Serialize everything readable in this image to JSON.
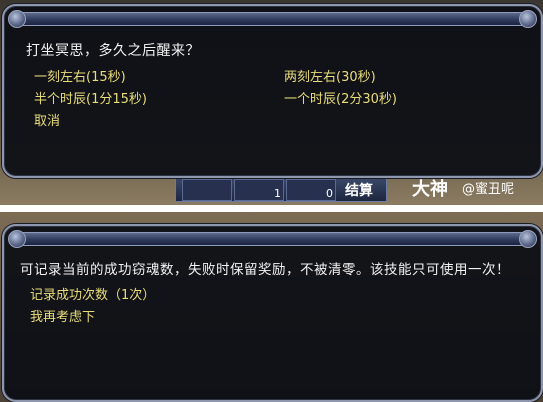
{
  "dialog_one": {
    "question": "打坐冥思，多久之后醒来？",
    "options": [
      "一刻左右(15秒)",
      "两刻左右(30秒)",
      "半个时辰(1分15秒)",
      "一个时辰(2分30秒)",
      "取消"
    ]
  },
  "hud": {
    "slot_counts": [
      "1",
      "0"
    ],
    "settle_label": "结算",
    "brand": "大神",
    "brand_sub": "@蜜丑呢"
  },
  "dialog_two": {
    "message": "可记录当前的成功窃魂数，失败时保留奖励，不被清零。该技能只可使用一次！",
    "options": [
      "记录成功次数（1次）",
      "我再考虑下"
    ]
  },
  "colors": {
    "option_text": "#e9dd7a",
    "message_text": "#f2f2f2",
    "frame": "#8e97ad"
  }
}
